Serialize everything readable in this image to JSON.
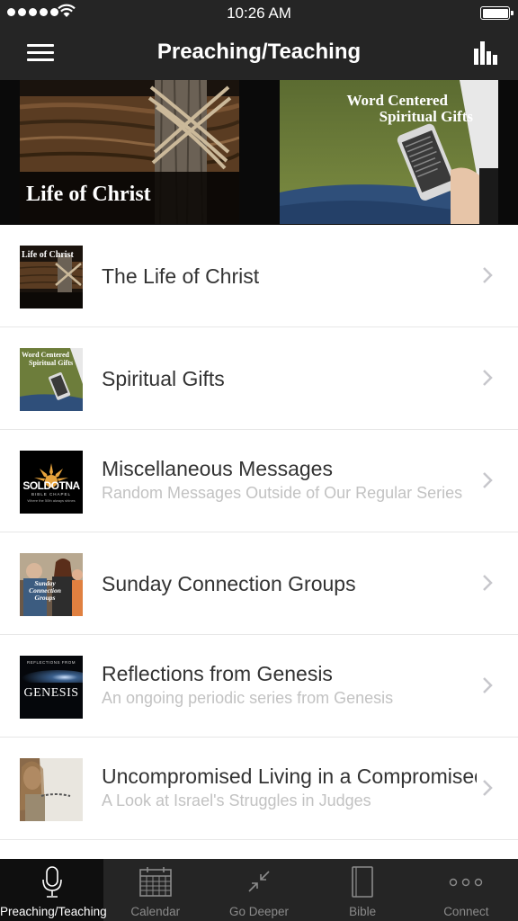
{
  "status_bar": {
    "time": "10:26 AM",
    "battery_level": 1.0
  },
  "nav": {
    "title": "Preaching/Teaching",
    "menu_icon": "hamburger-menu-icon",
    "right_icon": "bar-chart-icon"
  },
  "banner": {
    "left": {
      "title": "Life of Christ"
    },
    "right": {
      "title_line1": "Word Centered",
      "title_line2": "Spiritual Gifts"
    }
  },
  "series": [
    {
      "title": "The Life of Christ",
      "subtitle": "",
      "thumb": {
        "top": "Life of Christ"
      }
    },
    {
      "title": "Spiritual Gifts",
      "subtitle": "",
      "thumb": {
        "top": "Word Centered",
        "top2": "Spiritual Gifts"
      }
    },
    {
      "title": "Miscellaneous Messages",
      "subtitle": "Random Messages Outside of Our Regular Series",
      "thumb": {
        "logo": "SOLDOTNA",
        "sub": "BIBLE CHAPEL",
        "tag": "Where the 50th always shines"
      }
    },
    {
      "title": "Sunday Connection Groups",
      "subtitle": "",
      "thumb": {
        "line1": "Sunday",
        "line2": "Connection",
        "line3": "Groups"
      }
    },
    {
      "title": "Reflections from Genesis",
      "subtitle": "An ongoing periodic series from Genesis",
      "thumb": {
        "top": "REFLECTIONS FROM",
        "big": "GENESIS"
      }
    },
    {
      "title": "Uncompromised Living in a Compromised World",
      "subtitle": "A Look at Israel's Struggles in Judges",
      "thumb": {}
    }
  ],
  "tabs": [
    {
      "label": "Preaching/Teaching",
      "icon": "microphone-icon",
      "active": true
    },
    {
      "label": "Calendar",
      "icon": "calendar-icon",
      "active": false
    },
    {
      "label": "Go Deeper",
      "icon": "collapse-arrows-icon",
      "active": false
    },
    {
      "label": "Bible",
      "icon": "book-icon",
      "active": false
    },
    {
      "label": "Connect",
      "icon": "more-dots-icon",
      "active": false
    }
  ],
  "colors": {
    "bar_background": "#252525",
    "active_tab": "#0f0f0f",
    "title_text": "#333333",
    "subtitle_text": "#c2c2c2",
    "chevron": "#c7c7cc"
  }
}
